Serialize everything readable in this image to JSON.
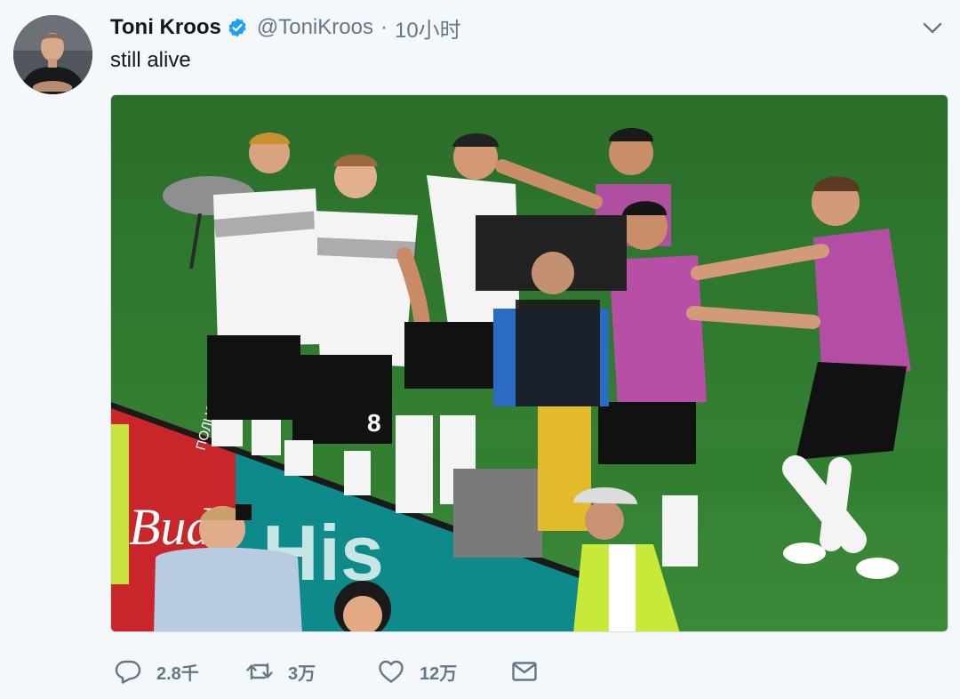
{
  "tweet": {
    "display_name": "Toni Kroos",
    "handle": "@ToniKroos",
    "separator": "·",
    "time": "10小时",
    "text": "still alive",
    "verified_color": "#1da1f2"
  },
  "actions": {
    "reply_count": "2.8千",
    "retweet_count": "3万",
    "like_count": "12万"
  },
  "media": {
    "sign_text_1": "Bud",
    "sign_text_2": "His",
    "sign_vertical": "ПОЛНОСТЬЮ"
  },
  "colors": {
    "muted": "#657786",
    "text": "#14171a",
    "accent": "#1da1f2",
    "pitch": "#2f7d2e"
  },
  "icons": [
    "reply-icon",
    "retweet-icon",
    "like-icon",
    "dm-icon",
    "chevron-down-icon",
    "verified-badge-icon"
  ]
}
